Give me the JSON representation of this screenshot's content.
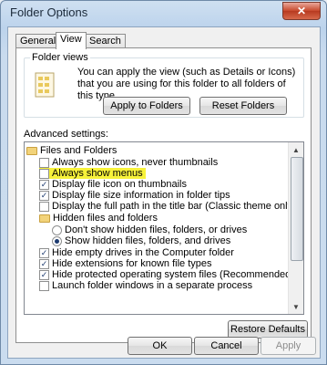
{
  "window": {
    "title": "Folder Options",
    "close_glyph": "✕"
  },
  "tabs": [
    {
      "label": "General",
      "active": false
    },
    {
      "label": "View",
      "active": true
    },
    {
      "label": "Search",
      "active": false
    }
  ],
  "folder_views": {
    "legend": "Folder views",
    "description": "You can apply the view (such as Details or Icons) that you are using for this folder to all folders of this type.",
    "apply_button": "Apply to Folders",
    "reset_button": "Reset Folders",
    "icon": "folder-views-icon"
  },
  "advanced": {
    "label": "Advanced settings:",
    "items": [
      {
        "type": "folder",
        "label": "Files and Folders",
        "indent": 0
      },
      {
        "type": "checkbox",
        "label": "Always show icons, never thumbnails",
        "checked": false,
        "indent": 1
      },
      {
        "type": "checkbox",
        "label": "Always show menus",
        "checked": false,
        "indent": 1,
        "highlighted": true
      },
      {
        "type": "checkbox",
        "label": "Display file icon on thumbnails",
        "checked": true,
        "indent": 1
      },
      {
        "type": "checkbox",
        "label": "Display file size information in folder tips",
        "checked": true,
        "indent": 1
      },
      {
        "type": "checkbox",
        "label": "Display the full path in the title bar (Classic theme only)",
        "checked": false,
        "indent": 1
      },
      {
        "type": "folder",
        "label": "Hidden files and folders",
        "indent": 1
      },
      {
        "type": "radio",
        "label": "Don't show hidden files, folders, or drives",
        "checked": false,
        "indent": 2
      },
      {
        "type": "radio",
        "label": "Show hidden files, folders, and drives",
        "checked": true,
        "indent": 2
      },
      {
        "type": "checkbox",
        "label": "Hide empty drives in the Computer folder",
        "checked": true,
        "indent": 1
      },
      {
        "type": "checkbox",
        "label": "Hide extensions for known file types",
        "checked": true,
        "indent": 1
      },
      {
        "type": "checkbox",
        "label": "Hide protected operating system files (Recommended)",
        "checked": true,
        "indent": 1
      },
      {
        "type": "checkbox",
        "label": "Launch folder windows in a separate process",
        "checked": false,
        "indent": 1
      }
    ],
    "highlight_color": "#f7f23a",
    "restore_button": "Restore Defaults"
  },
  "footer": {
    "ok": "OK",
    "cancel": "Cancel",
    "apply": "Apply"
  }
}
